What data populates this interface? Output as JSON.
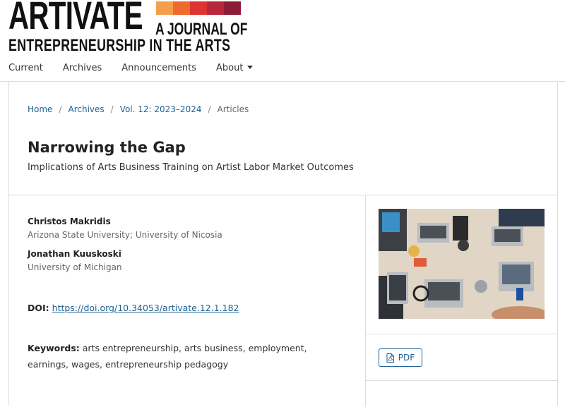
{
  "header": {
    "logo": {
      "title": "ARTIVATE",
      "subtitle_line1": "A JOURNAL OF",
      "subtitle_line2": "ENTREPRENEURSHIP IN THE ARTS",
      "bar_colors": [
        "#f4a04a",
        "#ee6b2f",
        "#dd3333",
        "#b8283a",
        "#8e1c38"
      ]
    },
    "nav": [
      {
        "label": "Current"
      },
      {
        "label": "Archives"
      },
      {
        "label": "Announcements"
      },
      {
        "label": "About"
      }
    ]
  },
  "breadcrumb": {
    "home": "Home",
    "archives": "Archives",
    "volume": "Vol. 12: 2023–2024",
    "current": "Articles",
    "separator": "/"
  },
  "article": {
    "title": "Narrowing the Gap",
    "subtitle": "Implications of Arts Business Training on Artist Labor Market Outcomes",
    "authors": [
      {
        "name": "Christos Makridis",
        "affiliation": "Arizona State University; University of Nicosia"
      },
      {
        "name": "Jonathan Kuuskoski",
        "affiliation": "University of Michigan"
      }
    ],
    "doi_label": "DOI:",
    "doi_link": "https://doi.org/10.34053/artivate.12.1.182",
    "keywords_label": "Keywords:",
    "keywords": "arts entrepreneurship, arts business, employment, earnings, wages, entrepreneurship pedagogy"
  },
  "sidebar": {
    "pdf_label": "PDF",
    "pdf_icon": "file-pdf-icon"
  },
  "colors": {
    "link": "#1e6292",
    "border": "#dddddd"
  }
}
